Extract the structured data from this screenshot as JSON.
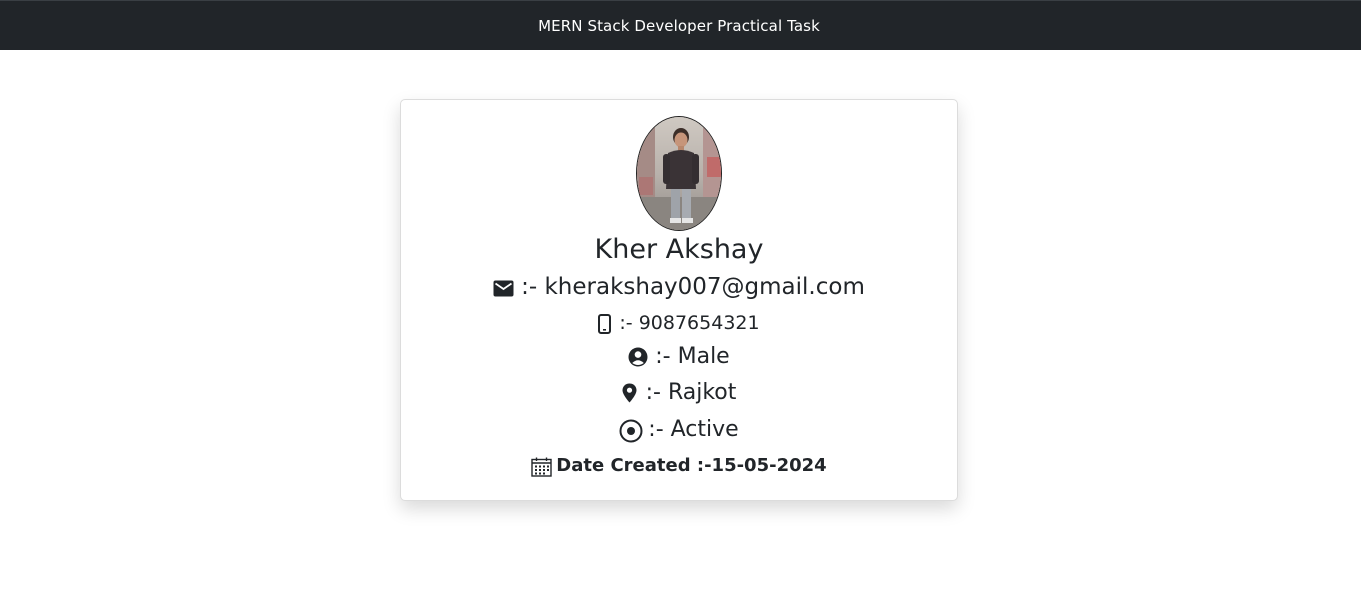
{
  "navbar": {
    "title": "MERN Stack Developer Practical Task"
  },
  "profile": {
    "name": "Kher Akshay",
    "email": ":- kherakshay007@gmail.com",
    "phone": ":- 9087654321",
    "gender": ":- Male",
    "city": ":- Rajkot",
    "status": ":- Active",
    "date_created": "Date Created :-15-05-2024"
  },
  "icons": {
    "email": "envelope-icon",
    "phone": "mobile-phone-icon",
    "gender": "user-circle-icon",
    "city": "map-pin-icon",
    "status": "record-circle-icon",
    "date": "calendar-icon"
  },
  "colors": {
    "navbar_bg": "#212529",
    "navbar_text": "#ffffff",
    "text": "#212529",
    "card_border": "#dcdcdc"
  }
}
